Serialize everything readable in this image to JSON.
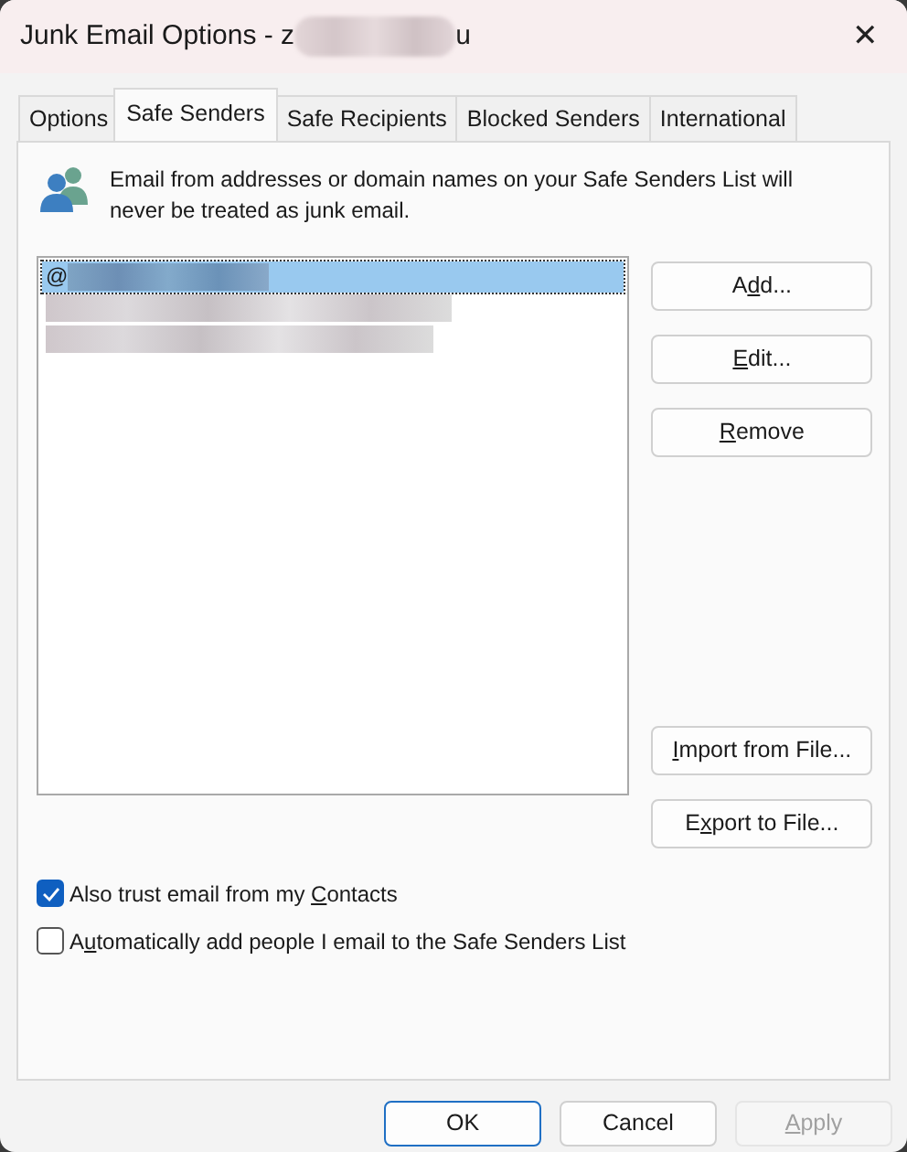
{
  "window": {
    "title_start": "Junk Email Options - z",
    "title_end": "u",
    "close": "✕"
  },
  "tabs": [
    {
      "label": "Options",
      "selected": false
    },
    {
      "label": "Safe Senders",
      "selected": true
    },
    {
      "label": "Safe Recipients",
      "selected": false
    },
    {
      "label": "Blocked Senders",
      "selected": false
    },
    {
      "label": "International",
      "selected": false
    }
  ],
  "info": "Email from addresses or domain names on your Safe Senders List will never be treated as junk email.",
  "list_entries": [
    {
      "kind": "address",
      "text": "@",
      "selected": true
    },
    {
      "kind": "redacted",
      "selected": false
    },
    {
      "kind": "redacted",
      "selected": false
    }
  ],
  "side_buttons": [
    {
      "before": "A",
      "key": "d",
      "after": "d..."
    },
    {
      "key": "E",
      "after": "dit..."
    },
    {
      "key": "R",
      "after": "emove"
    },
    {
      "kind": "gap"
    },
    {
      "key": "I",
      "after": "mport from File..."
    },
    {
      "before": "E",
      "key": "x",
      "after": "port to File..."
    }
  ],
  "checkboxes": [
    {
      "before": "Also trust email from my ",
      "key": "C",
      "after": "ontacts",
      "checked": true
    },
    {
      "before": "A",
      "key": "u",
      "after": "tomatically add people I email to the Safe Senders List",
      "checked": false
    }
  ],
  "footer_buttons": [
    {
      "before": "OK",
      "default": true,
      "disabled": false
    },
    {
      "before": "Cancel",
      "default": false,
      "disabled": false
    },
    {
      "key": "A",
      "after": "pply",
      "default": false,
      "disabled": true
    }
  ]
}
